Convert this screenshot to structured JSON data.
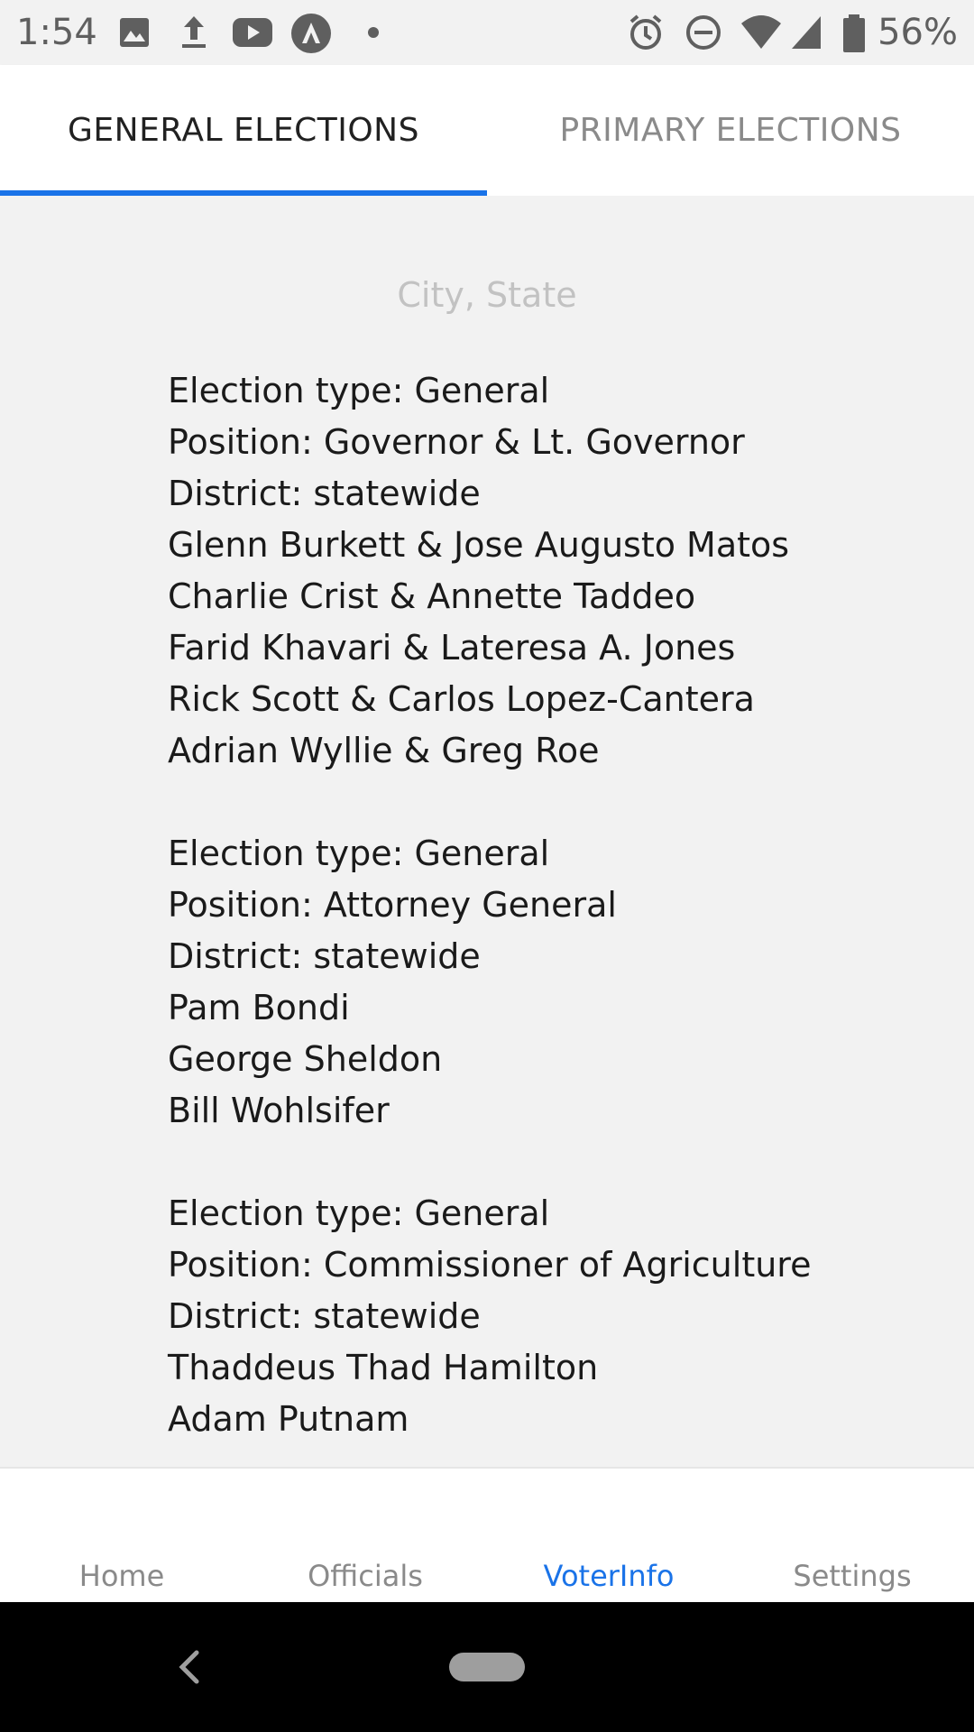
{
  "status_bar": {
    "time": "1:54",
    "battery_percent": "56%",
    "left_icons": [
      "image-icon",
      "upload-icon",
      "youtube-icon",
      "app-logo-icon",
      "dot-icon"
    ],
    "right_icons": [
      "alarm-icon",
      "do-not-disturb-icon",
      "wifi-icon",
      "signal-icon",
      "battery-icon"
    ]
  },
  "tabs": [
    {
      "label": "GENERAL ELECTIONS",
      "selected": true
    },
    {
      "label": "PRIMARY ELECTIONS",
      "selected": false
    }
  ],
  "content": {
    "location_placeholder": "City, State",
    "elections": [
      {
        "type_line": "Election type: General",
        "position_line": "Position: Governor & Lt. Governor",
        "district_line": "District: statewide",
        "candidates": [
          "Glenn Burkett & Jose Augusto Matos",
          "Charlie Crist & Annette Taddeo",
          "Farid Khavari & Lateresa A. Jones",
          "Rick Scott & Carlos Lopez-Cantera",
          "Adrian Wyllie & Greg Roe"
        ]
      },
      {
        "type_line": "Election type: General",
        "position_line": "Position: Attorney General",
        "district_line": "District: statewide",
        "candidates": [
          "Pam Bondi",
          "George Sheldon",
          "Bill Wohlsifer"
        ]
      },
      {
        "type_line": "Election type: General",
        "position_line": "Position: Commissioner of Agriculture",
        "district_line": "District: statewide",
        "candidates": [
          "Thaddeus Thad Hamilton",
          "Adam Putnam"
        ]
      }
    ]
  },
  "bottom_nav": {
    "items": [
      {
        "label": "Home",
        "active": false
      },
      {
        "label": "Officials",
        "active": false
      },
      {
        "label": "VoterInfo",
        "active": true
      },
      {
        "label": "Settings",
        "active": false
      }
    ]
  },
  "colors": {
    "accent": "#1a73e8",
    "background": "#f2f2f2",
    "text": "#1a1a1a",
    "muted": "#8a8a8a"
  }
}
